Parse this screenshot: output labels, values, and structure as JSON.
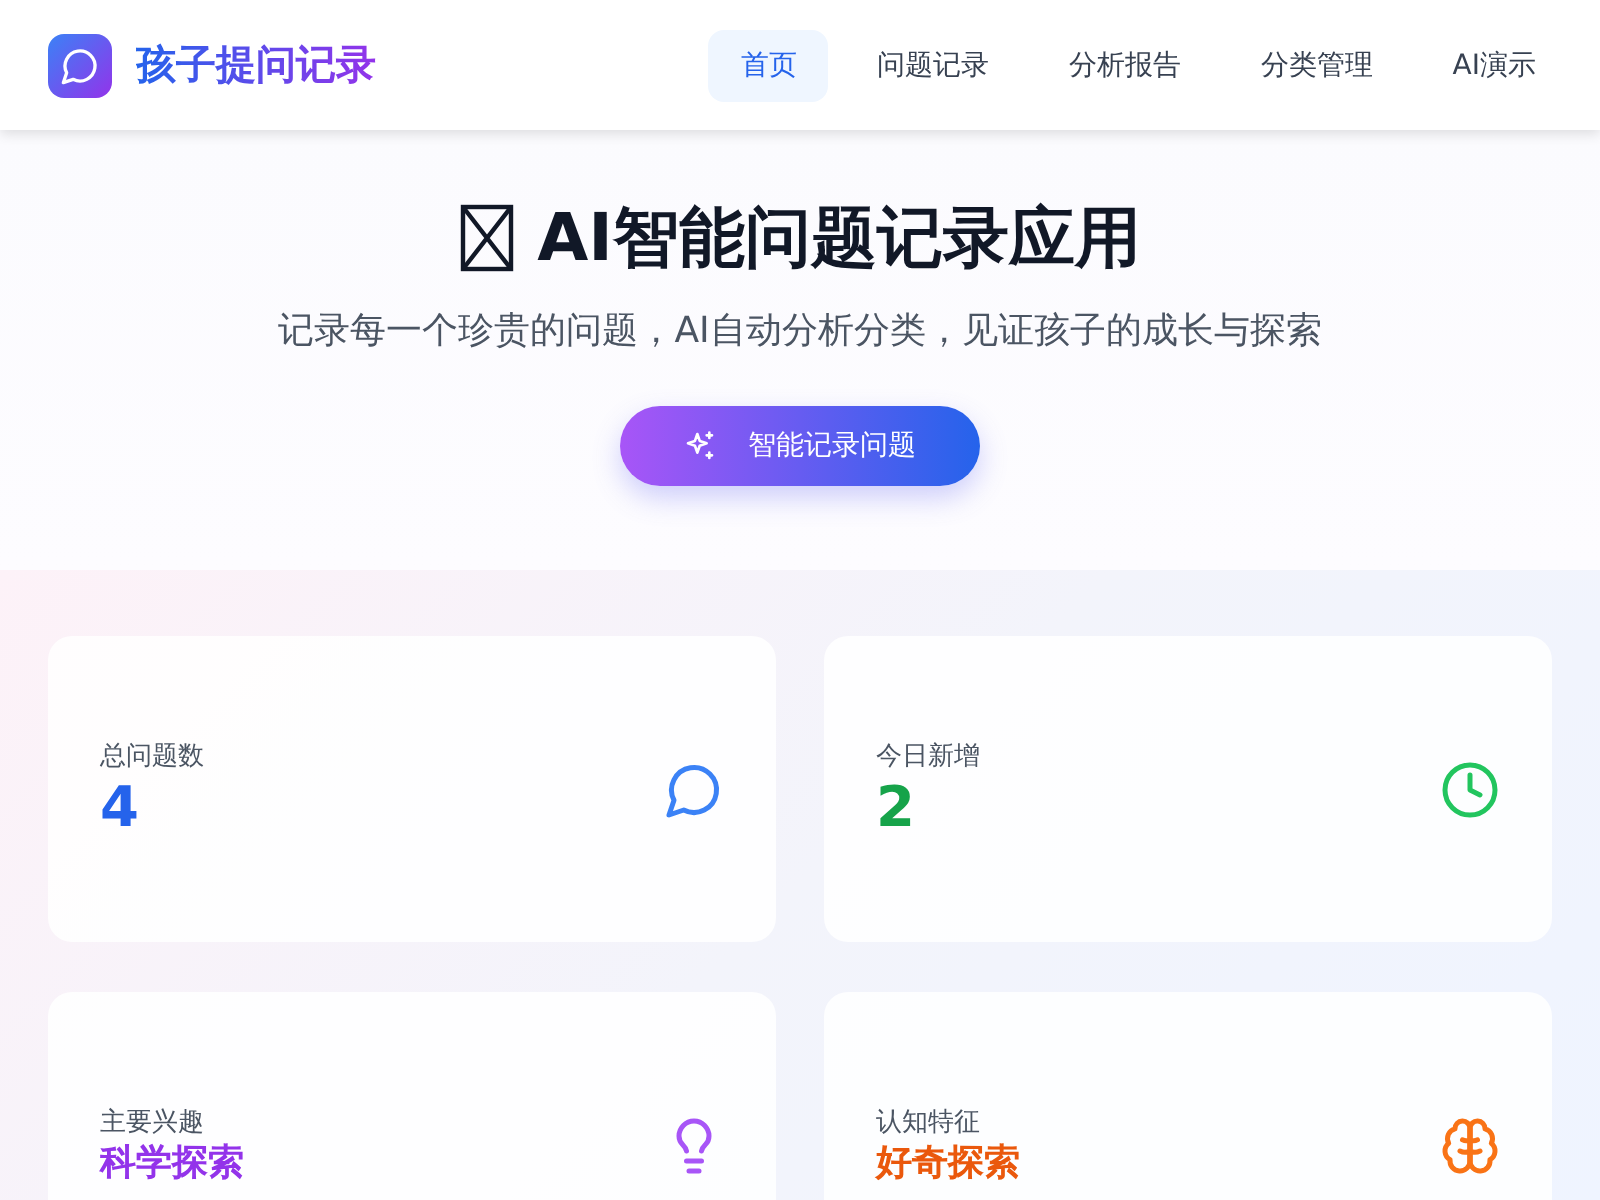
{
  "header": {
    "app_name": "孩子提问记录",
    "nav": [
      {
        "label": "首页",
        "selected": true
      },
      {
        "label": "问题记录",
        "selected": false
      },
      {
        "label": "分析报告",
        "selected": false
      },
      {
        "label": "分类管理",
        "selected": false
      },
      {
        "label": "AI演示",
        "selected": false
      }
    ]
  },
  "hero": {
    "title": "AI智能问题记录应用",
    "subtitle": "记录每一个珍贵的问题，AI自动分析分类，见证孩子的成长与探索",
    "button": "智能记录问题"
  },
  "stats": [
    {
      "kind": "chat",
      "label": "总问题数",
      "value": "4",
      "color": "#2563eb"
    },
    {
      "kind": "clock",
      "label": "今日新增",
      "value": "2",
      "color": "#16a34a"
    },
    {
      "kind": "bulb",
      "label": "主要兴趣",
      "value": "科学探索",
      "color": "#9333ea"
    },
    {
      "kind": "brain",
      "label": "认知特征",
      "value": "好奇探索",
      "color": "#ea580c"
    }
  ]
}
